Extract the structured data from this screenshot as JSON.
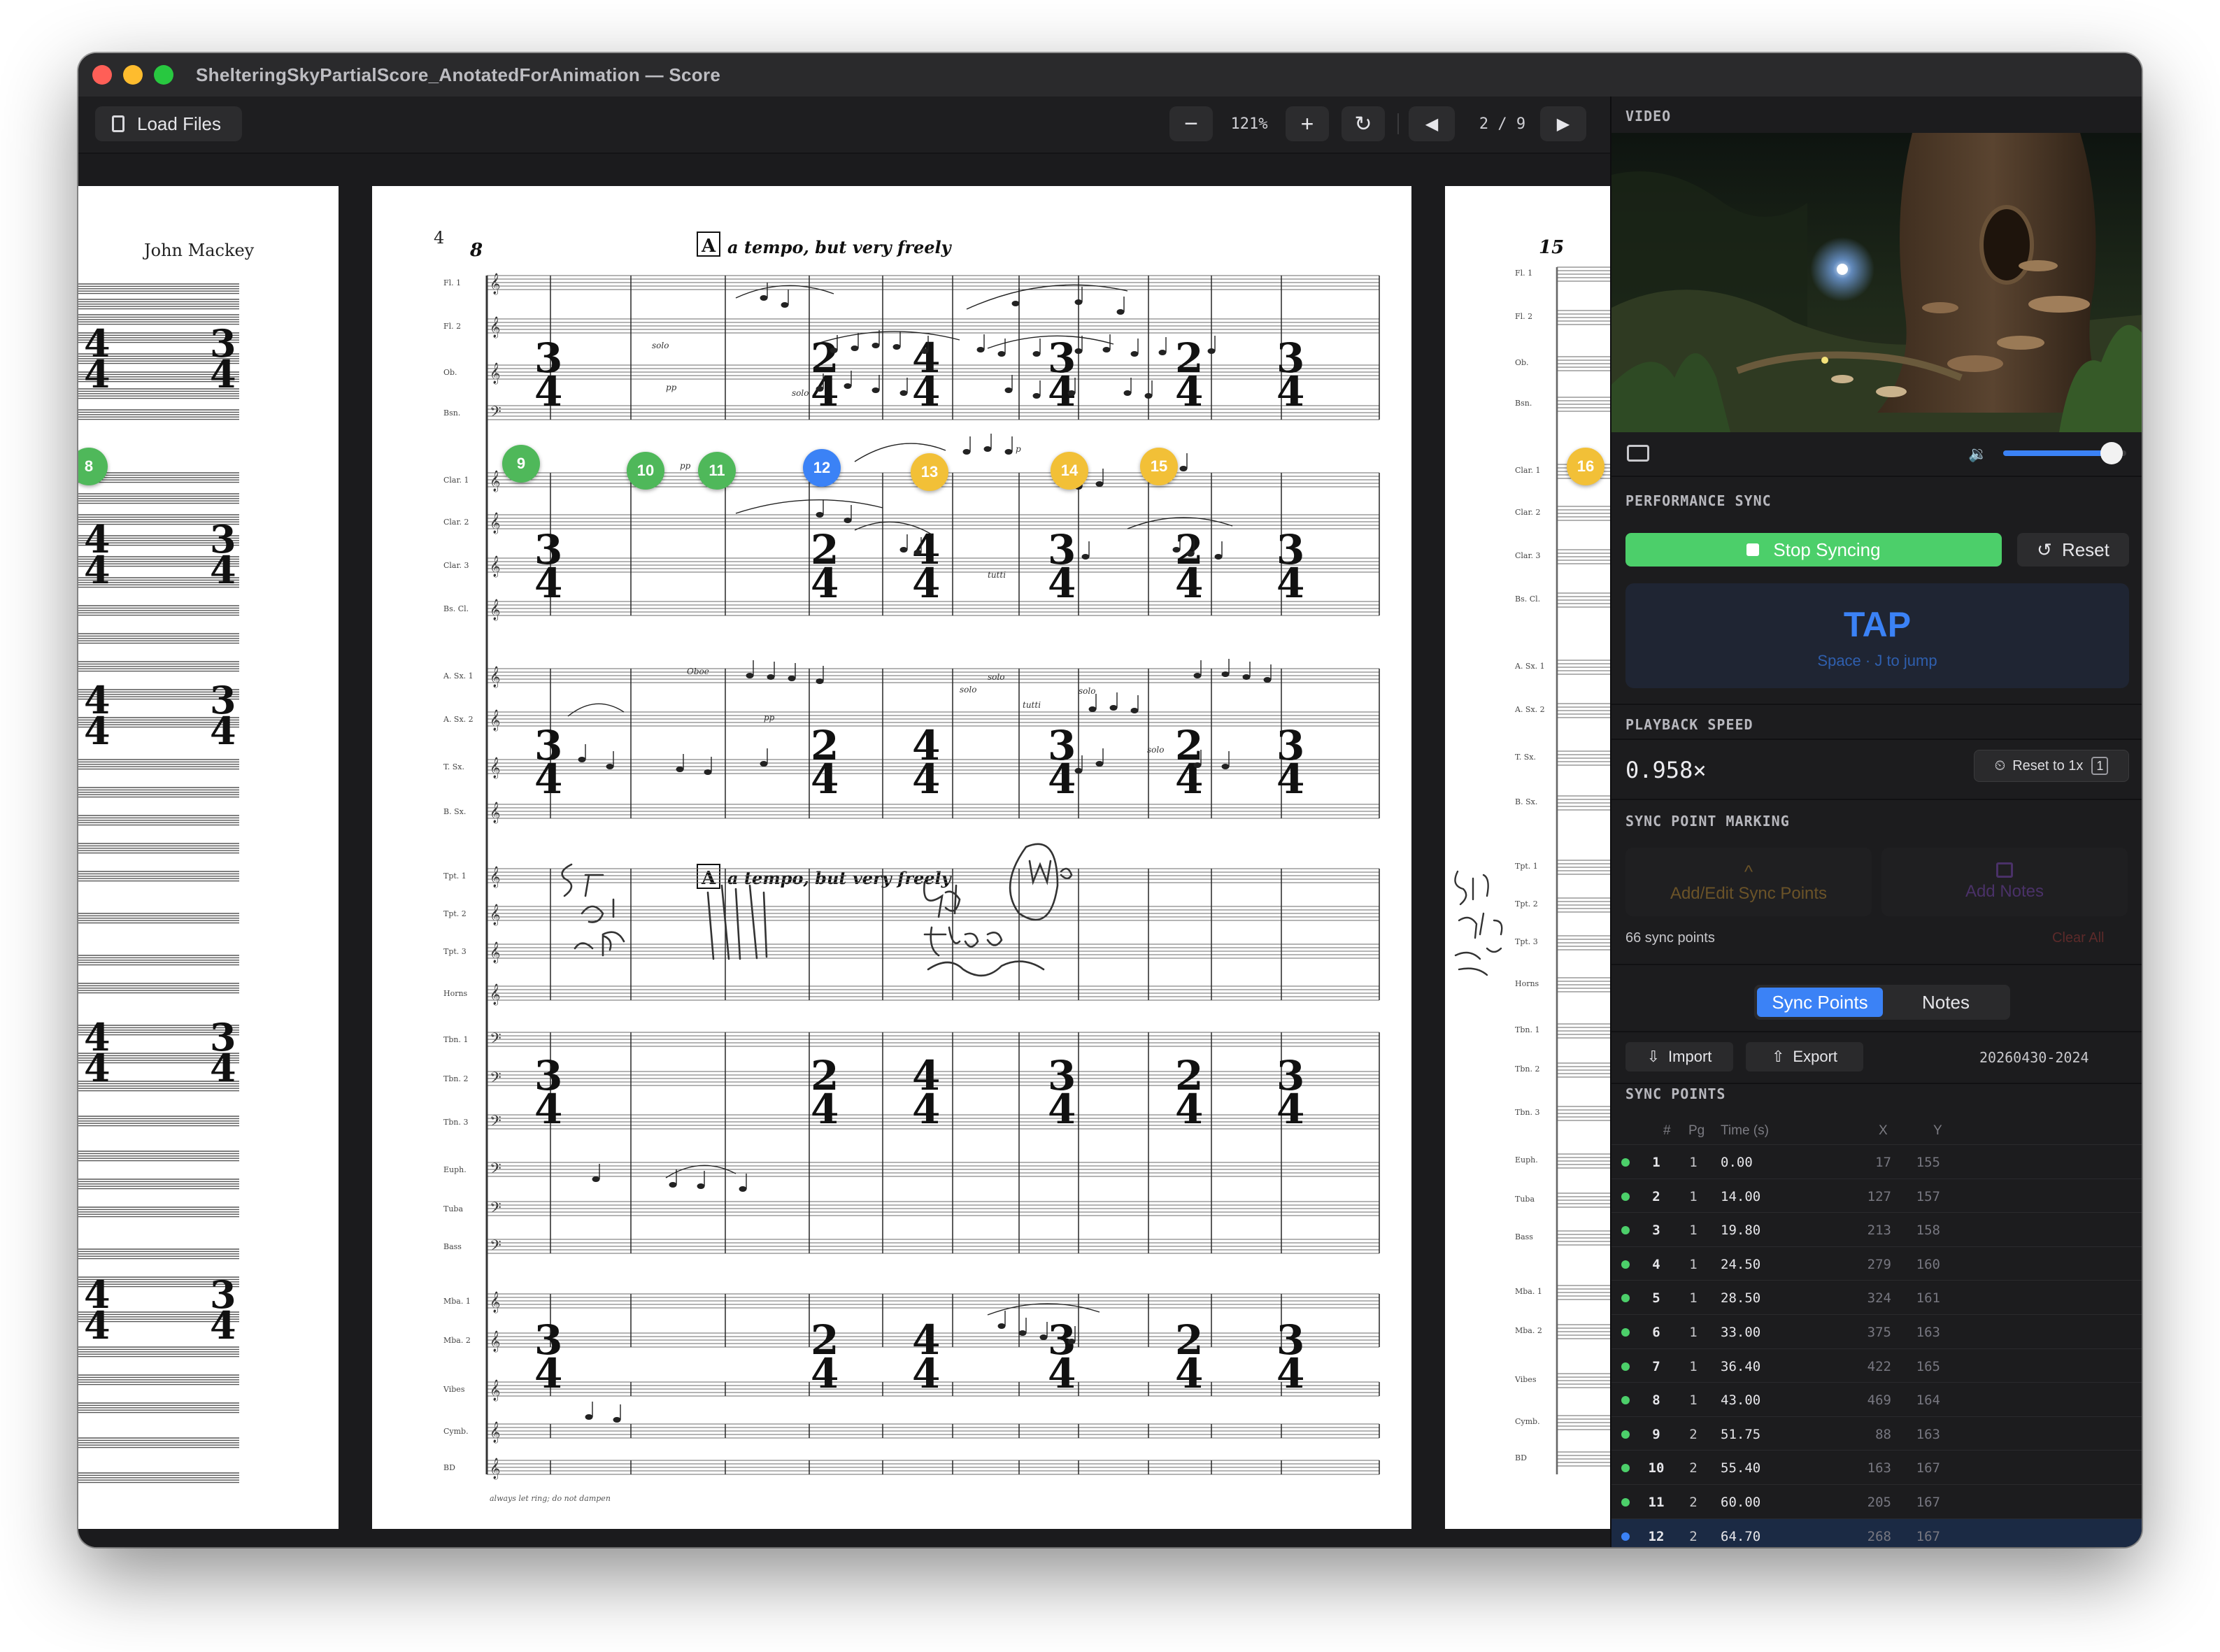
{
  "window": {
    "title": "ShelteringSkyPartialScore_AnotatedForAnimation — Score"
  },
  "toolbar": {
    "load_files": "Load Files",
    "zoom_out": "−",
    "zoom_level": "121%",
    "zoom_in": "+",
    "rotate": "↻",
    "prev_page": "◀",
    "page_indicator": "2 / 9",
    "next_page": "▶"
  },
  "score": {
    "composer": "John Mackey",
    "left_page_marker": "8",
    "main_page_number": "4",
    "main_measure_number": "8",
    "rehearsal_letter": "A",
    "tempo_marking": "a tempo, but very freely",
    "right_measure_number": "15",
    "right_page_marker": "16",
    "instruments": [
      "Fl. 1",
      "Fl. 2",
      "Ob.",
      "Bsn.",
      "Clar. 1",
      "Clar. 2",
      "Clar. 3",
      "Bs. Cl.",
      "A. Sx. 1",
      "A. Sx. 2",
      "T. Sx.",
      "B. Sx.",
      "Tpt. 1",
      "Tpt. 2",
      "Tpt. 3",
      "Horns",
      "Tbn. 1",
      "Tbn. 2",
      "Tbn. 3",
      "Euph.",
      "Tuba",
      "Bass",
      "Mba. 1",
      "Mba. 2",
      "Vibes",
      "Cymb.",
      "BD"
    ],
    "time_signatures": [
      "3/4",
      "2/4",
      "4/4",
      "3/4",
      "2/4",
      "3/4"
    ],
    "markers": [
      {
        "label": "9",
        "color": "#4fb85a"
      },
      {
        "label": "10",
        "color": "#4fb85a"
      },
      {
        "label": "11",
        "color": "#4fb85a"
      },
      {
        "label": "12",
        "color": "#3b82f6"
      },
      {
        "label": "13",
        "color": "#f2c037"
      },
      {
        "label": "14",
        "color": "#f2c037"
      },
      {
        "label": "15",
        "color": "#f2c037"
      }
    ],
    "handwritten_notes": [
      "Set bolts",
      "bird",
      "up",
      "tree",
      "wa"
    ],
    "footer_text": "always let ring; do not dampen",
    "expression_marks": [
      "solo",
      "pp",
      "p",
      "tutti",
      "Oboe"
    ]
  },
  "panel": {
    "video_label": "VIDEO",
    "volume": 0.88,
    "perf_sync_label": "PERFORMANCE SYNC",
    "stop_syncing": "Stop Syncing",
    "reset": "Reset",
    "tap_title": "TAP",
    "tap_hint": "Space · J to jump",
    "playback_speed_label": "PLAYBACK SPEED",
    "playback_speed": "0.958×",
    "reset_to_1x": "Reset to 1x",
    "reset_key": "1",
    "sync_marking_label": "SYNC POINT MARKING",
    "add_edit_sync": "Add/Edit Sync Points",
    "add_notes": "Add Notes",
    "sync_count": "66 sync points",
    "clear_all": "Clear All",
    "tab_sync_points": "Sync Points",
    "tab_notes": "Notes",
    "import": "Import",
    "export": "Export",
    "timestamp": "20260430-2024",
    "sync_points_label": "SYNC POINTS",
    "columns": {
      "num": "#",
      "pg": "Pg",
      "time": "Time (s)",
      "x": "X",
      "y": "Y"
    },
    "rows": [
      {
        "n": "1",
        "pg": "1",
        "t": "0.00",
        "x": "17",
        "y": "155"
      },
      {
        "n": "2",
        "pg": "1",
        "t": "14.00",
        "x": "127",
        "y": "157"
      },
      {
        "n": "3",
        "pg": "1",
        "t": "19.80",
        "x": "213",
        "y": "158"
      },
      {
        "n": "4",
        "pg": "1",
        "t": "24.50",
        "x": "279",
        "y": "160"
      },
      {
        "n": "5",
        "pg": "1",
        "t": "28.50",
        "x": "324",
        "y": "161"
      },
      {
        "n": "6",
        "pg": "1",
        "t": "33.00",
        "x": "375",
        "y": "163"
      },
      {
        "n": "7",
        "pg": "1",
        "t": "36.40",
        "x": "422",
        "y": "165"
      },
      {
        "n": "8",
        "pg": "1",
        "t": "43.00",
        "x": "469",
        "y": "164"
      },
      {
        "n": "9",
        "pg": "2",
        "t": "51.75",
        "x": "88",
        "y": "163"
      },
      {
        "n": "10",
        "pg": "2",
        "t": "55.40",
        "x": "163",
        "y": "167"
      },
      {
        "n": "11",
        "pg": "2",
        "t": "60.00",
        "x": "205",
        "y": "167"
      },
      {
        "n": "12",
        "pg": "2",
        "t": "64.70",
        "x": "268",
        "y": "167",
        "selected": true
      }
    ]
  }
}
